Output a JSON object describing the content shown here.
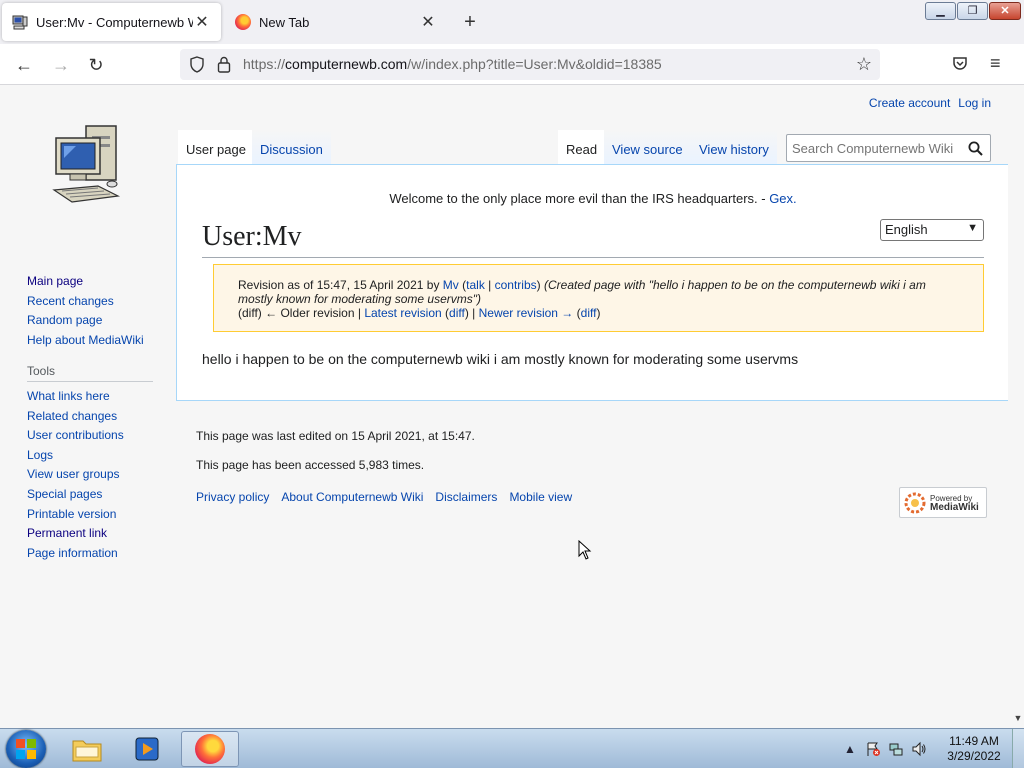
{
  "browser": {
    "tabs": [
      {
        "title": "User:Mv - Computernewb Wiki",
        "active": true
      },
      {
        "title": "New Tab",
        "active": false
      }
    ],
    "new_tab": "+",
    "close_glyph": "✕",
    "url_prefix": "https://",
    "url_host": "computernewb.com",
    "url_rest": "/w/index.php?title=User:Mv&oldid=18385"
  },
  "window_controls": {
    "minimize": "▁",
    "maximize": "❐",
    "close": "✕"
  },
  "nav": {
    "back": "←",
    "forward": "→",
    "reload": "↻",
    "star": "☆",
    "menu": "≡"
  },
  "wiki": {
    "personal": {
      "create_account": "Create account",
      "log_in": "Log in"
    },
    "sidebar_main": [
      "Main page",
      "Recent changes",
      "Random page",
      "Help about MediaWiki"
    ],
    "tools_heading": "Tools",
    "sidebar_tools": [
      "What links here",
      "Related changes",
      "User contributions",
      "Logs",
      "View user groups",
      "Special pages",
      "Printable version",
      "Permanent link",
      "Page information"
    ],
    "tabs": {
      "user_page": "User page",
      "discussion": "Discussion",
      "read": "Read",
      "view_source": "View source",
      "view_history": "View history"
    },
    "search_placeholder": "Search Computernewb Wiki",
    "sitenotice": "Welcome to the only place more evil than the IRS headquarters. - ",
    "sitenotice_link": "Gex.",
    "language": "English",
    "heading": "User:Mv",
    "revision": {
      "prefix": "Revision as of 15:47, 15 April 2021 by ",
      "user": "Mv",
      "talk": "talk",
      "contribs": "contribs",
      "summary": "(Created page with \"hello i happen to be on the computernewb wiki i am mostly known for moderating some uservms\")",
      "diff1": "(diff)",
      "older": "← Older revision",
      "latest": "Latest revision",
      "diff2": "diff",
      "newer": "Newer revision →",
      "diff3": "diff"
    },
    "body": "hello i happen to be on the computernewb wiki i am mostly known for moderating some uservms",
    "footer_edited": "This page was last edited on 15 April 2021, at 15:47.",
    "footer_accessed": "This page has been accessed 5,983 times.",
    "footer_links": [
      "Privacy policy",
      "About Computernewb Wiki",
      "Disclaimers",
      "Mobile view"
    ],
    "powered_by": "Powered by",
    "mediawiki": "MediaWiki"
  },
  "taskbar": {
    "time": "11:49 AM",
    "date": "3/29/2022"
  }
}
